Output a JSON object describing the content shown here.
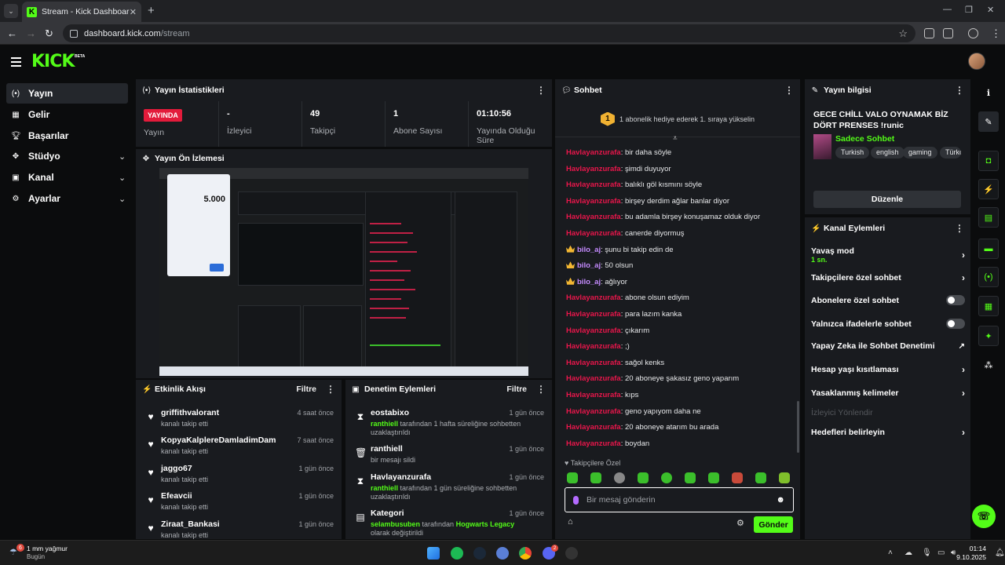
{
  "browser": {
    "tab_title": "Stream - Kick Dashboard",
    "url_host": "dashboard.kick.com",
    "url_path": "/stream"
  },
  "brand": {
    "logo": "KICK",
    "beta": "BETA",
    "accent": "#53fc18"
  },
  "sidebar": {
    "items": [
      {
        "label": "Yayın",
        "icon": "broadcast-icon"
      },
      {
        "label": "Gelir",
        "icon": "revenue-icon"
      },
      {
        "label": "Başarılar",
        "icon": "trophy-icon"
      },
      {
        "label": "Stüdyo",
        "icon": "studio-icon"
      },
      {
        "label": "Kanal",
        "icon": "channel-icon"
      },
      {
        "label": "Ayarlar",
        "icon": "gear-icon"
      }
    ]
  },
  "stats_panel": {
    "title": "Yayın İstatistikleri",
    "live_badge": "YAYINDA",
    "live_label": "Yayın",
    "viewers_value": "-",
    "viewers_label": "İzleyici",
    "followers_value": "49",
    "followers_label": "Takipçi",
    "subs_value": "1",
    "subs_label": "Abone Sayısı",
    "duration_value": "01:10:56",
    "duration_label": "Yayında Olduğu Süre"
  },
  "preview_panel": {
    "title": "Yayın Ön İzlemesi",
    "calc_display": "5.000"
  },
  "activity_panel": {
    "title": "Etkinlik Akışı",
    "filter": "Filtre",
    "items": [
      {
        "name": "griffithvalorant",
        "time": "4 saat önce",
        "sub": "kanalı takip etti"
      },
      {
        "name": "KopyaKalplereDamladimDam",
        "time": "7 saat önce",
        "sub": "kanalı takip etti"
      },
      {
        "name": "jaggo67",
        "time": "1 gün önce",
        "sub": "kanalı takip etti"
      },
      {
        "name": "Efeavcii",
        "time": "1 gün önce",
        "sub": "kanalı takip etti"
      },
      {
        "name": "Ziraat_Bankasi",
        "time": "1 gün önce",
        "sub": "kanalı takip etti"
      }
    ]
  },
  "moderation_panel": {
    "title": "Denetim Eylemleri",
    "filter": "Filtre",
    "items": [
      {
        "name": "eostabixo",
        "time": "1 gün önce",
        "actor": "ranthiell",
        "sub": " tarafından 1 hafta süreliğine sohbetten uzaklaştırıldı",
        "icon": "hourglass-icon"
      },
      {
        "name": "ranthiell",
        "time": "1 gün önce",
        "actor": "",
        "sub": "bir mesajı sildi",
        "icon": "trash-icon"
      },
      {
        "name": "Havlayanzurafa",
        "time": "1 gün önce",
        "actor": "ranthiell",
        "sub": " tarafından 1 gün süreliğine sohbetten uzaklaştırıldı",
        "icon": "hourglass-icon"
      },
      {
        "name": "Kategori",
        "time": "1 gün önce",
        "actor": "selambusuben",
        "sub": " tarafından ",
        "extra": "Hogwarts Legacy",
        "extra2": " olarak değiştirildi",
        "icon": "category-icon"
      }
    ]
  },
  "chat_panel": {
    "title": "Sohbet",
    "pin_rank": "1",
    "pin_text": "1 abonelik hediye ederek 1. sıraya yükselin",
    "messages": [
      {
        "user": "Havlayanzurafa",
        "text": "bir daha söyle",
        "type": "normal"
      },
      {
        "user": "Havlayanzurafa",
        "text": "şimdi duyuyor",
        "type": "normal"
      },
      {
        "user": "Havlayanzurafa",
        "text": "balıklı göl kısmını söyle",
        "type": "normal"
      },
      {
        "user": "Havlayanzurafa",
        "text": "birşey derdim ağlar banlar diyor",
        "type": "normal"
      },
      {
        "user": "Havlayanzurafa",
        "text": "bu adamla birşey konuşamaz olduk diyor",
        "type": "normal"
      },
      {
        "user": "Havlayanzurafa",
        "text": "canerde diyormuş",
        "type": "normal"
      },
      {
        "user": "bilo_aj",
        "text": "şunu bi takip edin de",
        "type": "crown"
      },
      {
        "user": "bilo_aj",
        "text": "50 olsun",
        "type": "crown"
      },
      {
        "user": "bilo_aj",
        "text": "ağlıyor",
        "type": "crown"
      },
      {
        "user": "Havlayanzurafa",
        "text": "abone olsun ediyim",
        "type": "normal"
      },
      {
        "user": "Havlayanzurafa",
        "text": "para lazım kanka",
        "type": "normal"
      },
      {
        "user": "Havlayanzurafa",
        "text": "çıkarım",
        "type": "normal"
      },
      {
        "user": "Havlayanzurafa",
        "text": ";)",
        "type": "normal"
      },
      {
        "user": "Havlayanzurafa",
        "text": "sağol kenks",
        "type": "normal"
      },
      {
        "user": "Havlayanzurafa",
        "text": "20 aboneye şakasız geno yaparım",
        "type": "normal"
      },
      {
        "user": "Havlayanzurafa",
        "text": "kıps",
        "type": "normal"
      },
      {
        "user": "Havlayanzurafa",
        "text": "geno yapıyom daha ne",
        "type": "normal"
      },
      {
        "user": "Havlayanzurafa",
        "text": "20 aboneye atarım bu arada",
        "type": "normal"
      },
      {
        "user": "Havlayanzurafa",
        "text": "boydan",
        "type": "normal"
      }
    ],
    "followers_only_label": "Takipçilere Özel",
    "input_placeholder": "Bir mesaj gönderin",
    "send_label": "Gönder"
  },
  "info_panel": {
    "title": "Yayın bilgisi",
    "stream_title": "GECE CHİLL VALO OYNAMAK BİZ DÖRT PRENSES !runic",
    "category": "Sadece Sohbet",
    "tags": [
      "Turkish",
      "english",
      "gaming",
      "Türkç"
    ],
    "edit_label": "Düzenle"
  },
  "channel_actions": {
    "title": "Kanal Eylemleri",
    "slow_mode": "Yavaş mod",
    "slow_mode_value": "1 sn.",
    "items": [
      {
        "label": "Takipçilere özel sohbet",
        "control": "chevron"
      },
      {
        "label": "Abonelere özel sohbet",
        "control": "toggle"
      },
      {
        "label": "Yalnızca ifadelerle sohbet",
        "control": "toggle"
      },
      {
        "label": "Yapay Zeka ile Sohbet Denetimi",
        "control": "external"
      },
      {
        "label": "Hesap yaşı kısıtlaması",
        "control": "chevron"
      },
      {
        "label": "Yasaklanmış kelimeler",
        "control": "chevron"
      }
    ],
    "disabled_item": "İzleyici Yönlendir",
    "goals_label": "Hedefleri belirleyin"
  },
  "taskbar": {
    "weather_badge": "6",
    "weather_text": "1 mm yağmur",
    "weather_sub": "Bugün",
    "time": "01:14",
    "date": "9.10.2025",
    "discord_badge": "2"
  }
}
